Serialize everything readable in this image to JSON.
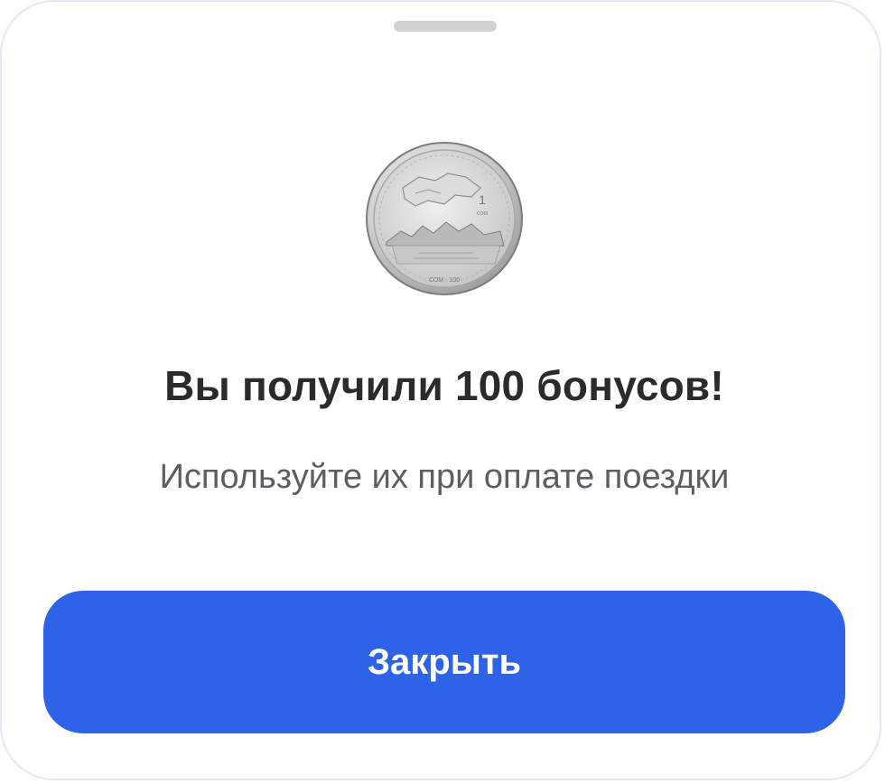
{
  "dialog": {
    "title": "Вы получили 100 бонусов!",
    "subtitle": "Используйте их при оплате поездки",
    "close_label": "Закрыть",
    "coin": {
      "denomination": "1",
      "currency": "сом",
      "inscription": "СОМ - 100"
    }
  },
  "colors": {
    "accent": "#2f63e7",
    "title_text": "#2b2b2d",
    "subtitle_text": "#5d5e63",
    "grabber": "#d0d1d5",
    "sheet_border": "#e3e8f4"
  },
  "icons": {
    "coin": "coin-icon",
    "grabber": "drag-handle"
  }
}
